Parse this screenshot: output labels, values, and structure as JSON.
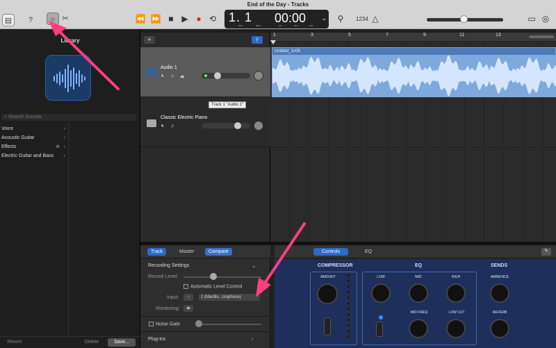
{
  "window": {
    "title": "End of the Day - Tracks"
  },
  "toolbar": {
    "icons": [
      "library-icon",
      "help-icon",
      "smart-controls-icon",
      "editors-scissors-icon",
      "rewind-icon",
      "forward-icon",
      "stop-icon",
      "play-icon",
      "record-icon",
      "cycle-icon",
      "tuner-icon",
      "count-in-icon",
      "metronome-icon",
      "notepad-icon",
      "loops-icon"
    ],
    "count_in": "1234"
  },
  "lcd": {
    "bars_beats": "1. 1",
    "time": "00:00",
    "bar_label": "BAR",
    "beat_label": "BEAT",
    "hr_label": "HR",
    "min_label": "MIN",
    "sec_label": "SEC"
  },
  "library": {
    "title": "Library",
    "search_placeholder": "Search Sounds",
    "categories": [
      "Voice",
      "Acoustic Guitar",
      "Effects",
      "Electric Guitar and Bass"
    ],
    "revert": "Revert",
    "delete": "Delete",
    "save": "Save..."
  },
  "tracks": [
    {
      "name": "Audio 1",
      "selected": true
    },
    {
      "name": "Classic Electric Piano",
      "selected": false
    }
  ],
  "tooltip": "Track 1 \"Audio 1\"",
  "ruler": {
    "numbers": [
      "1",
      "3",
      "5",
      "7",
      "9",
      "11",
      "13"
    ]
  },
  "region": {
    "name": "Untitled_1#05"
  },
  "editor": {
    "tabs": {
      "track": "Track",
      "master": "Master",
      "compare": "Compare",
      "controls": "Controls",
      "eq": "EQ"
    },
    "recording_settings": "Recording Settings",
    "record_level": "Record Level:",
    "auto_level": "Automatic Level Control",
    "input_label": "Input:",
    "input_value": "1  (MacBo...crophone)",
    "monitoring_label": "Monitoring:",
    "noise_gate": "Noise Gate",
    "plugins": "Plug-ins"
  },
  "fx": {
    "compressor": "COMPRESSOR",
    "eq": "EQ",
    "sends": "SENDS",
    "amount": "AMOUNT",
    "low": "LOW",
    "mid": "MID",
    "high": "HIGH",
    "mid_freq": "MID FREQ",
    "low_cut": "LOW CUT",
    "ambience": "AMBIENCE",
    "reverb": "REVERB"
  },
  "colors": {
    "accent": "#2c6ac4",
    "region": "#4a7ab8",
    "annotation": "#ff3f7f"
  }
}
